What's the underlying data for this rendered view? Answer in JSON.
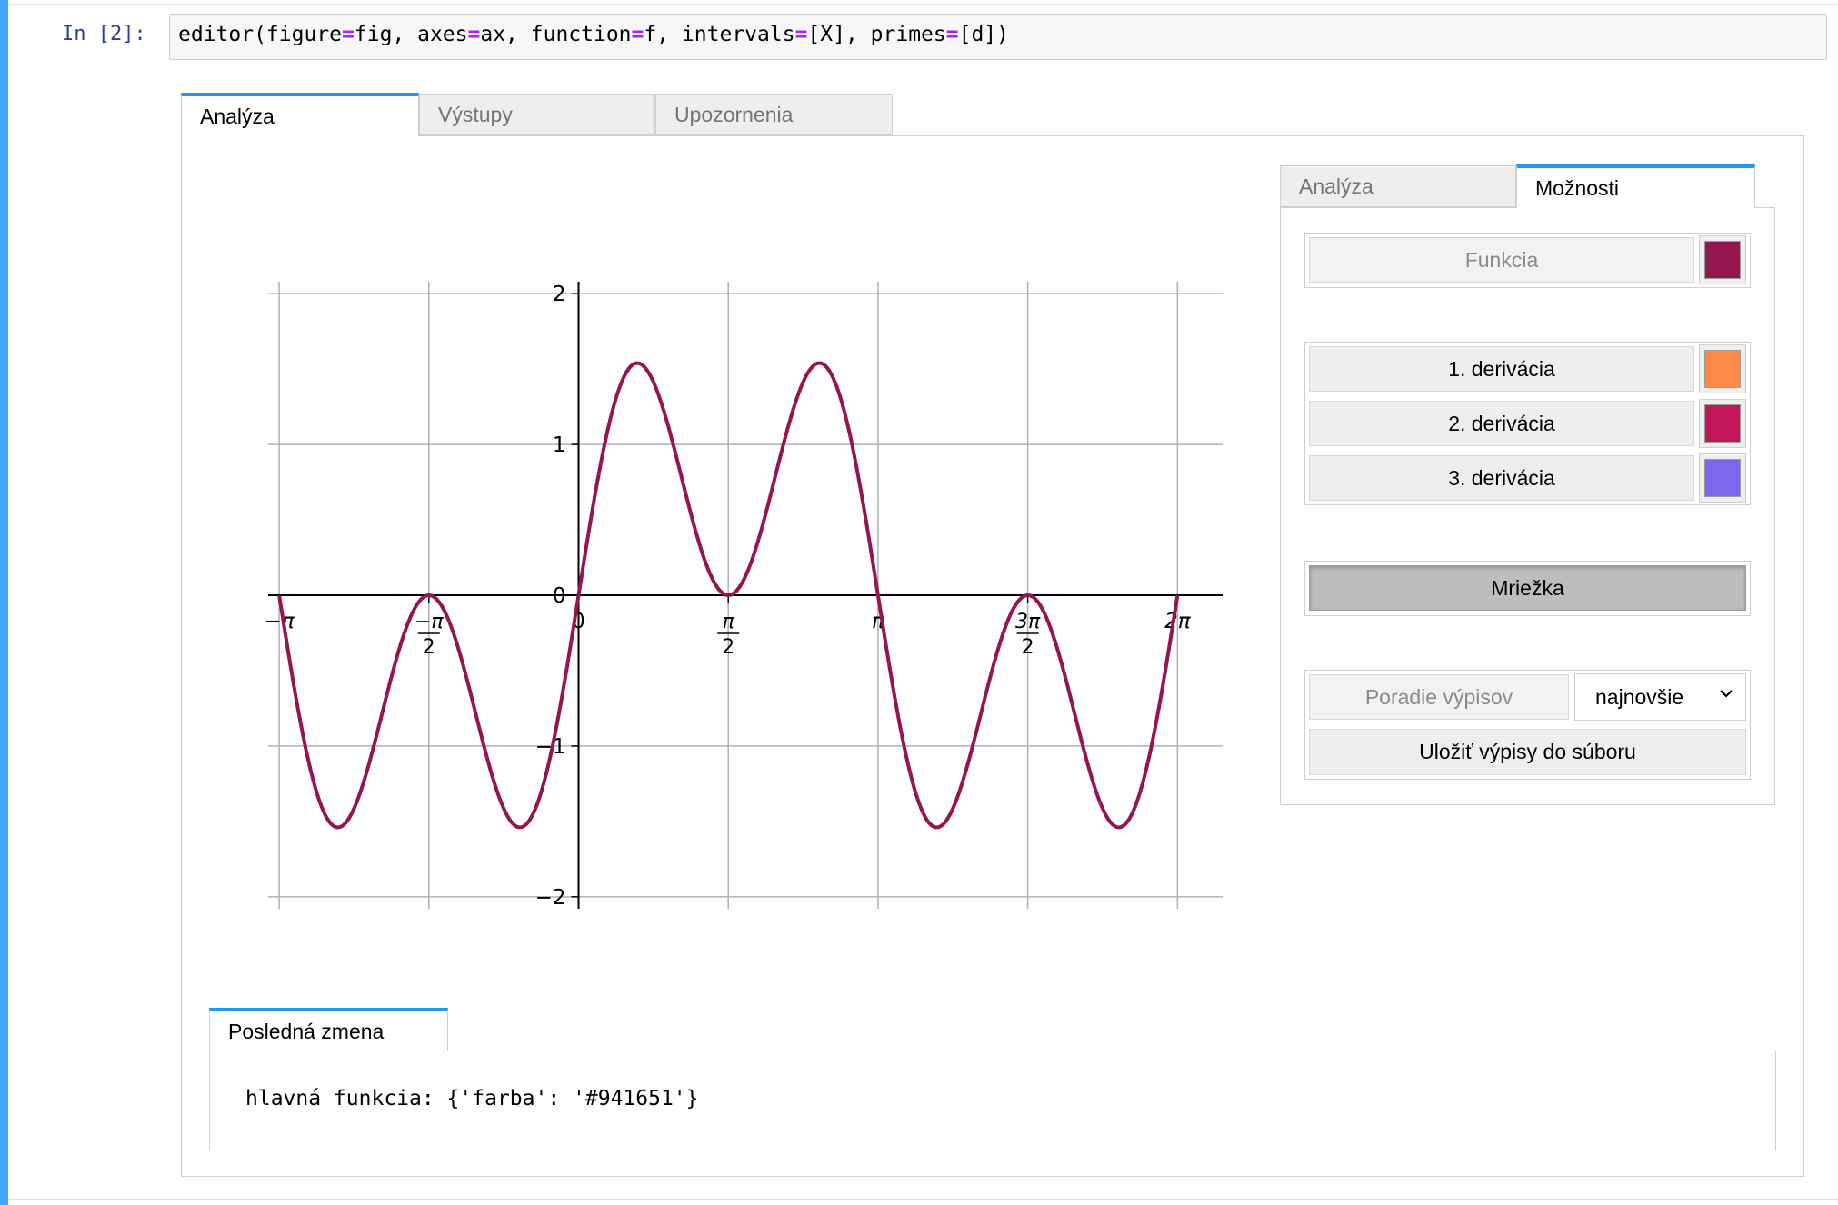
{
  "cell": {
    "prompt": "In [2]:",
    "code": [
      {
        "t": "editor(figure",
        "op": false
      },
      {
        "t": "=",
        "op": true
      },
      {
        "t": "fig, axes",
        "op": false
      },
      {
        "t": "=",
        "op": true
      },
      {
        "t": "ax, function",
        "op": false
      },
      {
        "t": "=",
        "op": true
      },
      {
        "t": "f, intervals",
        "op": false
      },
      {
        "t": "=",
        "op": true
      },
      {
        "t": "[X], primes",
        "op": false
      },
      {
        "t": "=",
        "op": true
      },
      {
        "t": "[d])",
        "op": false
      }
    ]
  },
  "main_tabs": [
    {
      "label": "Analýza",
      "active": true
    },
    {
      "label": "Výstupy",
      "active": false
    },
    {
      "label": "Upozornenia",
      "active": false
    }
  ],
  "side_tabs": [
    {
      "label": "Analýza",
      "active": false
    },
    {
      "label": "Možnosti",
      "active": true
    }
  ],
  "options": {
    "function_label": "Funkcia",
    "function_color": "#941651",
    "derivatives": [
      {
        "label": "1. derivácia",
        "color": "#ff8a47"
      },
      {
        "label": "2. derivácia",
        "color": "#c2185b"
      },
      {
        "label": "3. derivácia",
        "color": "#7b68ee"
      }
    ],
    "grid_label": "Mriežka",
    "grid_on": true,
    "order_label": "Poradie výpisov",
    "order_value": "najnovšie",
    "save_label": "Uložiť výpisy do súboru"
  },
  "last_change": {
    "tab_label": "Posledná zmena",
    "text": "hlavná funkcia: {'farba': '#941651'}"
  },
  "chart_data": {
    "type": "line",
    "series": [
      {
        "expression": "sin(x) + sin(3x)",
        "color": "#941651"
      }
    ],
    "xlim": [
      -3.4,
      6.9
    ],
    "ylim": [
      -2.2,
      2.2
    ],
    "x_ticks": [
      {
        "value": -3.14159,
        "label": "−π"
      },
      {
        "value": -1.5708,
        "label": "−π/2"
      },
      {
        "value": 0,
        "label": "0"
      },
      {
        "value": 1.5708,
        "label": "π/2"
      },
      {
        "value": 3.14159,
        "label": "π"
      },
      {
        "value": 4.71239,
        "label": "3π/2"
      },
      {
        "value": 6.28319,
        "label": "2π"
      }
    ],
    "y_ticks": [
      {
        "value": 2,
        "label": "2"
      },
      {
        "value": 1,
        "label": "1"
      },
      {
        "value": 0,
        "label": "0"
      },
      {
        "value": -1,
        "label": "−1"
      },
      {
        "value": -2,
        "label": "−2"
      }
    ],
    "domain": [
      -3.14159,
      6.28319
    ],
    "grid": true
  }
}
